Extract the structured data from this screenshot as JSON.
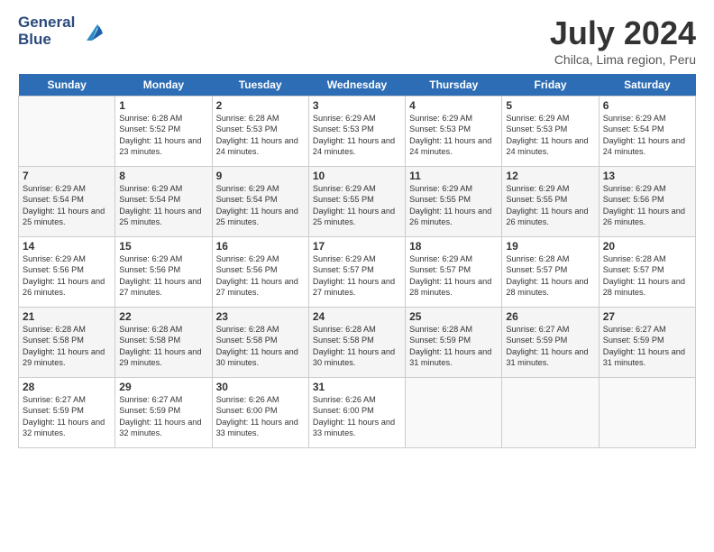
{
  "logo": {
    "line1": "General",
    "line2": "Blue"
  },
  "title": "July 2024",
  "subtitle": "Chilca, Lima region, Peru",
  "headers": [
    "Sunday",
    "Monday",
    "Tuesday",
    "Wednesday",
    "Thursday",
    "Friday",
    "Saturday"
  ],
  "weeks": [
    [
      {
        "date": "",
        "sunrise": "",
        "sunset": "",
        "daylight": ""
      },
      {
        "date": "1",
        "sunrise": "Sunrise: 6:28 AM",
        "sunset": "Sunset: 5:52 PM",
        "daylight": "Daylight: 11 hours and 23 minutes."
      },
      {
        "date": "2",
        "sunrise": "Sunrise: 6:28 AM",
        "sunset": "Sunset: 5:53 PM",
        "daylight": "Daylight: 11 hours and 24 minutes."
      },
      {
        "date": "3",
        "sunrise": "Sunrise: 6:29 AM",
        "sunset": "Sunset: 5:53 PM",
        "daylight": "Daylight: 11 hours and 24 minutes."
      },
      {
        "date": "4",
        "sunrise": "Sunrise: 6:29 AM",
        "sunset": "Sunset: 5:53 PM",
        "daylight": "Daylight: 11 hours and 24 minutes."
      },
      {
        "date": "5",
        "sunrise": "Sunrise: 6:29 AM",
        "sunset": "Sunset: 5:53 PM",
        "daylight": "Daylight: 11 hours and 24 minutes."
      },
      {
        "date": "6",
        "sunrise": "Sunrise: 6:29 AM",
        "sunset": "Sunset: 5:54 PM",
        "daylight": "Daylight: 11 hours and 24 minutes."
      }
    ],
    [
      {
        "date": "7",
        "sunrise": "Sunrise: 6:29 AM",
        "sunset": "Sunset: 5:54 PM",
        "daylight": "Daylight: 11 hours and 25 minutes."
      },
      {
        "date": "8",
        "sunrise": "Sunrise: 6:29 AM",
        "sunset": "Sunset: 5:54 PM",
        "daylight": "Daylight: 11 hours and 25 minutes."
      },
      {
        "date": "9",
        "sunrise": "Sunrise: 6:29 AM",
        "sunset": "Sunset: 5:54 PM",
        "daylight": "Daylight: 11 hours and 25 minutes."
      },
      {
        "date": "10",
        "sunrise": "Sunrise: 6:29 AM",
        "sunset": "Sunset: 5:55 PM",
        "daylight": "Daylight: 11 hours and 25 minutes."
      },
      {
        "date": "11",
        "sunrise": "Sunrise: 6:29 AM",
        "sunset": "Sunset: 5:55 PM",
        "daylight": "Daylight: 11 hours and 26 minutes."
      },
      {
        "date": "12",
        "sunrise": "Sunrise: 6:29 AM",
        "sunset": "Sunset: 5:55 PM",
        "daylight": "Daylight: 11 hours and 26 minutes."
      },
      {
        "date": "13",
        "sunrise": "Sunrise: 6:29 AM",
        "sunset": "Sunset: 5:56 PM",
        "daylight": "Daylight: 11 hours and 26 minutes."
      }
    ],
    [
      {
        "date": "14",
        "sunrise": "Sunrise: 6:29 AM",
        "sunset": "Sunset: 5:56 PM",
        "daylight": "Daylight: 11 hours and 26 minutes."
      },
      {
        "date": "15",
        "sunrise": "Sunrise: 6:29 AM",
        "sunset": "Sunset: 5:56 PM",
        "daylight": "Daylight: 11 hours and 27 minutes."
      },
      {
        "date": "16",
        "sunrise": "Sunrise: 6:29 AM",
        "sunset": "Sunset: 5:56 PM",
        "daylight": "Daylight: 11 hours and 27 minutes."
      },
      {
        "date": "17",
        "sunrise": "Sunrise: 6:29 AM",
        "sunset": "Sunset: 5:57 PM",
        "daylight": "Daylight: 11 hours and 27 minutes."
      },
      {
        "date": "18",
        "sunrise": "Sunrise: 6:29 AM",
        "sunset": "Sunset: 5:57 PM",
        "daylight": "Daylight: 11 hours and 28 minutes."
      },
      {
        "date": "19",
        "sunrise": "Sunrise: 6:28 AM",
        "sunset": "Sunset: 5:57 PM",
        "daylight": "Daylight: 11 hours and 28 minutes."
      },
      {
        "date": "20",
        "sunrise": "Sunrise: 6:28 AM",
        "sunset": "Sunset: 5:57 PM",
        "daylight": "Daylight: 11 hours and 28 minutes."
      }
    ],
    [
      {
        "date": "21",
        "sunrise": "Sunrise: 6:28 AM",
        "sunset": "Sunset: 5:58 PM",
        "daylight": "Daylight: 11 hours and 29 minutes."
      },
      {
        "date": "22",
        "sunrise": "Sunrise: 6:28 AM",
        "sunset": "Sunset: 5:58 PM",
        "daylight": "Daylight: 11 hours and 29 minutes."
      },
      {
        "date": "23",
        "sunrise": "Sunrise: 6:28 AM",
        "sunset": "Sunset: 5:58 PM",
        "daylight": "Daylight: 11 hours and 30 minutes."
      },
      {
        "date": "24",
        "sunrise": "Sunrise: 6:28 AM",
        "sunset": "Sunset: 5:58 PM",
        "daylight": "Daylight: 11 hours and 30 minutes."
      },
      {
        "date": "25",
        "sunrise": "Sunrise: 6:28 AM",
        "sunset": "Sunset: 5:59 PM",
        "daylight": "Daylight: 11 hours and 31 minutes."
      },
      {
        "date": "26",
        "sunrise": "Sunrise: 6:27 AM",
        "sunset": "Sunset: 5:59 PM",
        "daylight": "Daylight: 11 hours and 31 minutes."
      },
      {
        "date": "27",
        "sunrise": "Sunrise: 6:27 AM",
        "sunset": "Sunset: 5:59 PM",
        "daylight": "Daylight: 11 hours and 31 minutes."
      }
    ],
    [
      {
        "date": "28",
        "sunrise": "Sunrise: 6:27 AM",
        "sunset": "Sunset: 5:59 PM",
        "daylight": "Daylight: 11 hours and 32 minutes."
      },
      {
        "date": "29",
        "sunrise": "Sunrise: 6:27 AM",
        "sunset": "Sunset: 5:59 PM",
        "daylight": "Daylight: 11 hours and 32 minutes."
      },
      {
        "date": "30",
        "sunrise": "Sunrise: 6:26 AM",
        "sunset": "Sunset: 6:00 PM",
        "daylight": "Daylight: 11 hours and 33 minutes."
      },
      {
        "date": "31",
        "sunrise": "Sunrise: 6:26 AM",
        "sunset": "Sunset: 6:00 PM",
        "daylight": "Daylight: 11 hours and 33 minutes."
      },
      {
        "date": "",
        "sunrise": "",
        "sunset": "",
        "daylight": ""
      },
      {
        "date": "",
        "sunrise": "",
        "sunset": "",
        "daylight": ""
      },
      {
        "date": "",
        "sunrise": "",
        "sunset": "",
        "daylight": ""
      }
    ]
  ]
}
